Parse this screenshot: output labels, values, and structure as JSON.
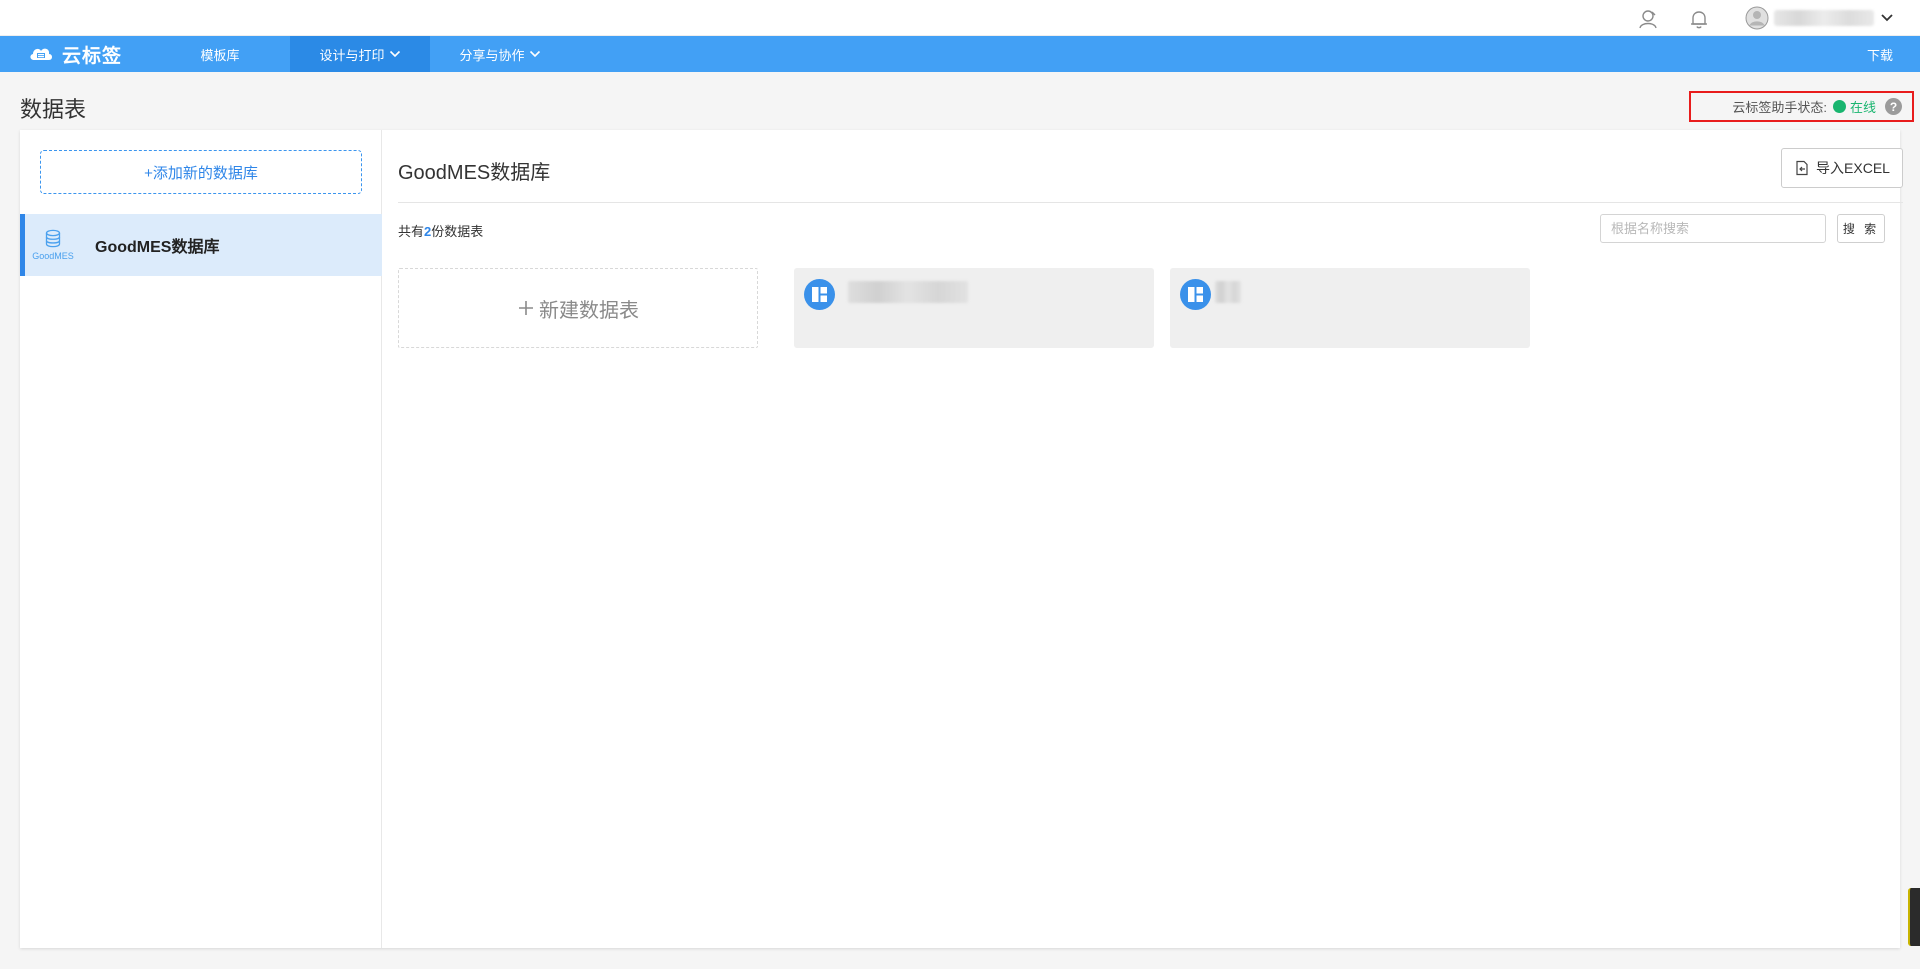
{
  "header": {
    "user_name": "",
    "icons": [
      "user-manage-icon",
      "bell-icon",
      "avatar",
      "chevron-down-icon"
    ]
  },
  "nav": {
    "brand": "云标签",
    "items": [
      {
        "label": "模板库"
      },
      {
        "label": "设计与打印",
        "has_dropdown": true,
        "active": true
      },
      {
        "label": "分享与协作",
        "has_dropdown": true
      }
    ],
    "download": "下载"
  },
  "page": {
    "title": "数据表",
    "helper_status_label": "云标签助手状态:",
    "helper_status_value": "在线",
    "help_glyph": "?"
  },
  "sidebar": {
    "add_db_label": "+添加新的数据库",
    "databases": [
      {
        "logo_text": "GoodMES",
        "name": "GoodMES数据库",
        "selected": true
      }
    ]
  },
  "main": {
    "db_title": "GoodMES数据库",
    "import_label": "导入EXCEL",
    "count_prefix": "共有",
    "count": "2",
    "count_suffix": "份数据表",
    "search": {
      "placeholder": "根据名称搜索",
      "value": "",
      "button": "搜 索"
    },
    "new_table_label": "新建数据表",
    "tables": [
      {
        "name": ""
      },
      {
        "name": ""
      }
    ]
  },
  "colors": {
    "nav_bg": "#42a0f5",
    "nav_active": "#2b8ae6",
    "accent": "#2f86e8",
    "online": "#19b56f",
    "highlight_border": "#e81c1c"
  }
}
